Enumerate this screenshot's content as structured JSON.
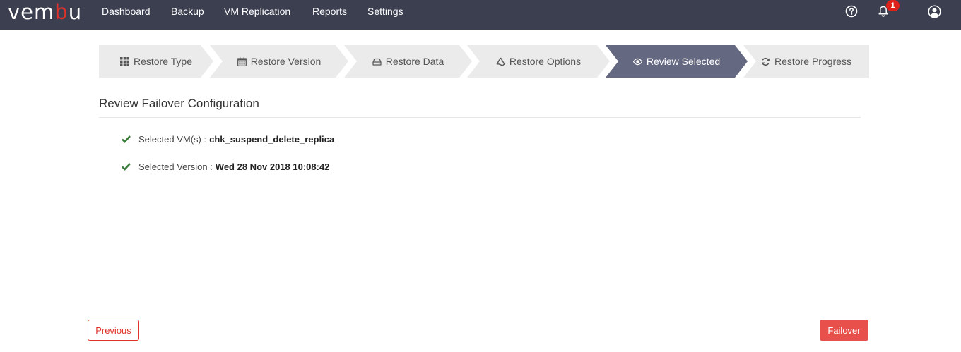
{
  "brand": {
    "logo_prefix": "vem",
    "logo_accent": "b",
    "logo_suffix": "u",
    "accent_color": "#e0322b",
    "nav_bg": "#3b3f50"
  },
  "nav": {
    "items": [
      "Dashboard",
      "Backup",
      "VM Replication",
      "Reports",
      "Settings"
    ],
    "help_icon": "help-circle-icon",
    "notification_icon": "bell-icon",
    "notification_count": "1",
    "user_icon": "user-circle-icon"
  },
  "wizard": {
    "steps": [
      {
        "label": "Restore Type",
        "icon": "grid-icon"
      },
      {
        "label": "Restore Version",
        "icon": "calendar-icon"
      },
      {
        "label": "Restore Data",
        "icon": "hdd-icon"
      },
      {
        "label": "Restore Options",
        "icon": "recycle-icon"
      },
      {
        "label": "Review Selected",
        "icon": "eye-icon"
      },
      {
        "label": "Restore Progress",
        "icon": "refresh-icon"
      }
    ],
    "active_step": "Review Selected",
    "active_color": "#656881"
  },
  "review": {
    "title": "Review Failover Configuration",
    "rows": [
      {
        "label": "Selected VM(s) :",
        "value": "chk_suspend_delete_replica",
        "icon": "check-icon"
      },
      {
        "label": "Selected Version :",
        "value": "Wed 28 Nov 2018 10:08:42",
        "icon": "check-icon"
      }
    ],
    "check_color": "#3a7d3a"
  },
  "actions": {
    "previous_label": "Previous",
    "failover_label": "Failover"
  }
}
